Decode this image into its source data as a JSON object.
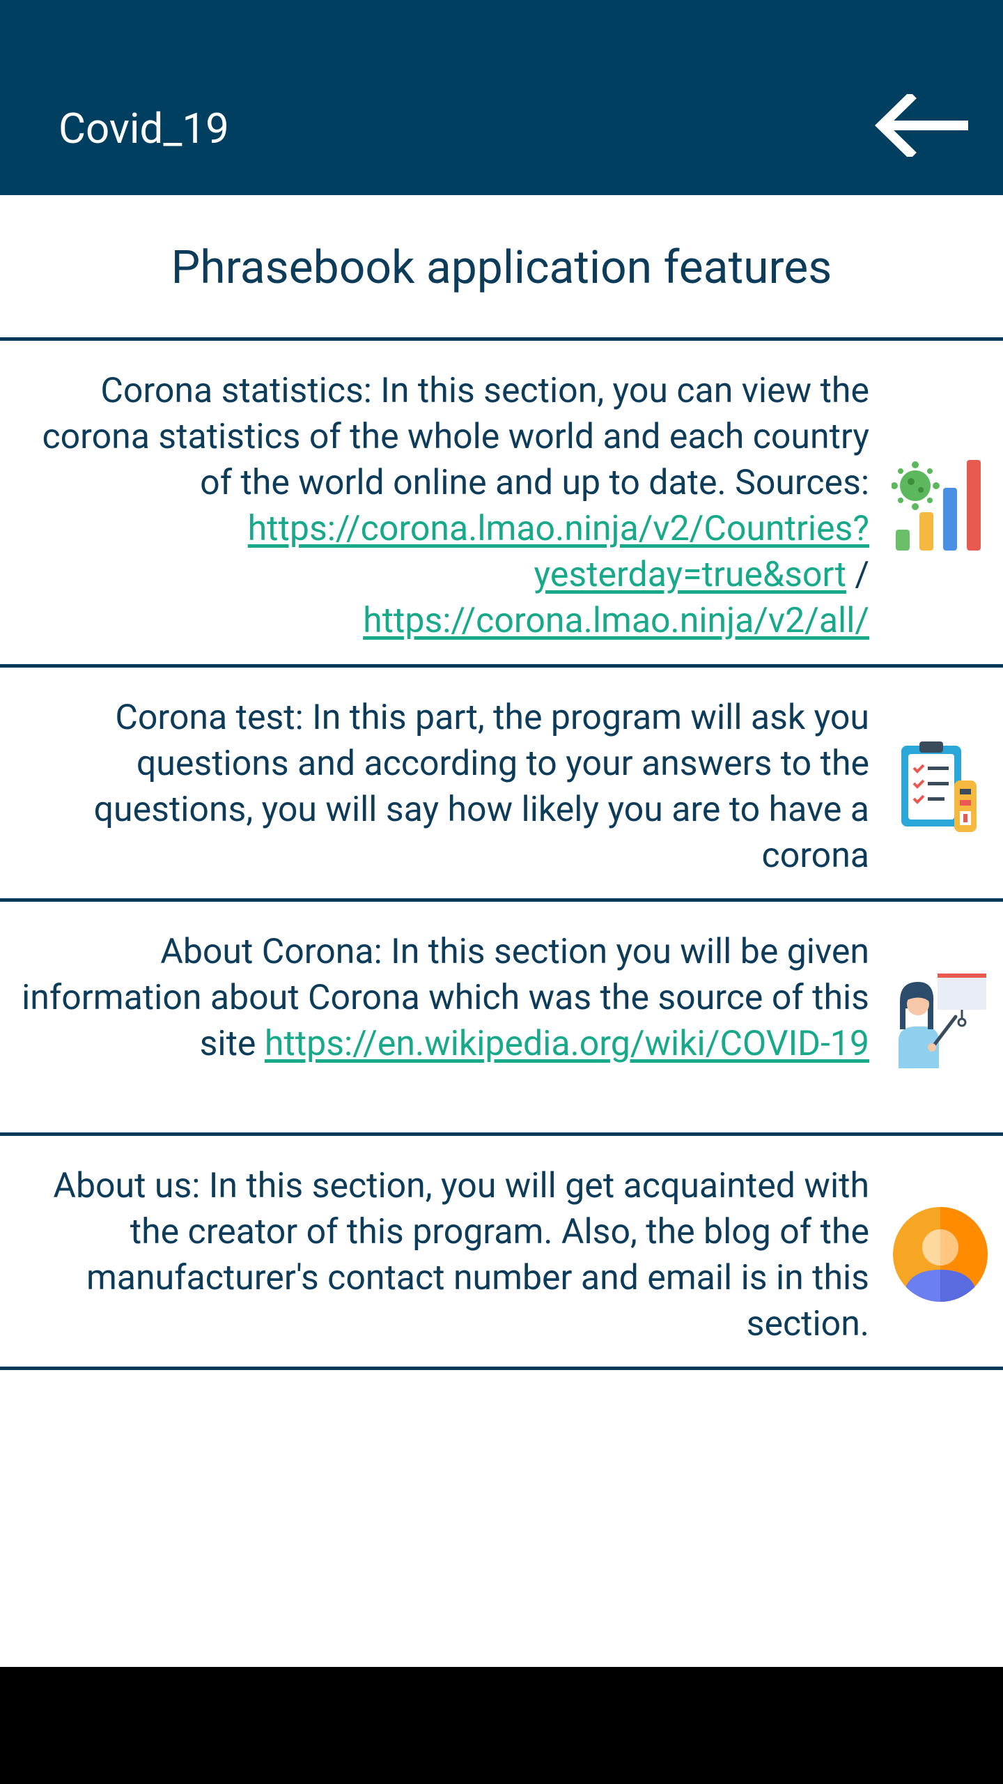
{
  "app_bar": {
    "title": "Covid_19"
  },
  "page": {
    "title": "Phrasebook application features"
  },
  "features": {
    "statistics": {
      "text": "Corona statistics: In this section, you can view the corona statistics of the whole world and each country of the world online and up to date. Sources:",
      "link1": "https://corona.lmao.ninja/v2/Countries?yesterday=true&sort",
      "separator": " / ",
      "link2": "https://corona.lmao.ninja/v2/all/",
      "icon": "chart-virus-icon"
    },
    "test": {
      "text": "Corona test: In this part, the program will ask you questions and according to your answers to the questions, you will say how likely you are to have a corona",
      "icon": "clipboard-test-icon"
    },
    "about_corona": {
      "text": "About Corona: In this section you will be given information about Corona which was the source of this site",
      "link": "https://en.wikipedia.org/wiki/COVID-19",
      "icon": "teacher-presentation-icon"
    },
    "about_us": {
      "text": "About us: In this section, you will get acquainted with the creator of this program. Also, the blog of the manufacturer's contact number and email is in this section.",
      "icon": "user-avatar-icon"
    }
  },
  "colors": {
    "primary": "#013f61",
    "link": "#18a88a",
    "text": "#0d3b5a"
  }
}
